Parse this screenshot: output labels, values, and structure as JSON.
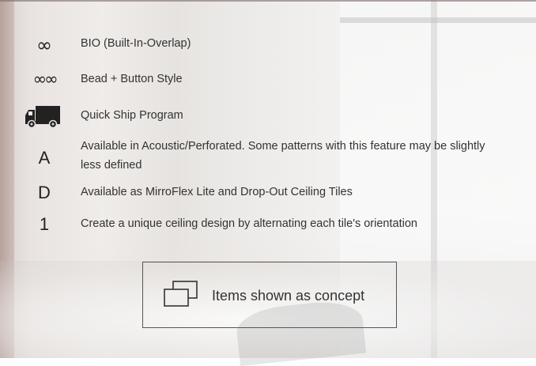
{
  "legend": {
    "items": [
      {
        "icon": "∞",
        "icon_name": "infinity-icon",
        "label": "BIO (Built-In-Overlap)"
      },
      {
        "icon": "∞∞",
        "icon_name": "double-infinity-icon",
        "label": "Bead + Button Style"
      },
      {
        "icon": "",
        "icon_name": "truck-icon",
        "label": "Quick Ship Program"
      },
      {
        "icon": "A",
        "icon_name": "letter-a-icon",
        "label": "Available in Acoustic/Perforated. Some patterns with this feature may be slightly less defined"
      },
      {
        "icon": "D",
        "icon_name": "letter-d-icon",
        "label": "Available as MirroFlex Lite and Drop-Out Ceiling Tiles"
      },
      {
        "icon": "1",
        "icon_name": "number-1-icon",
        "label": "Create a unique ceiling design by alternating each tile's orientation"
      }
    ]
  },
  "concept_note": {
    "icon_name": "overlapping-squares-icon",
    "label": "Items shown as concept"
  }
}
